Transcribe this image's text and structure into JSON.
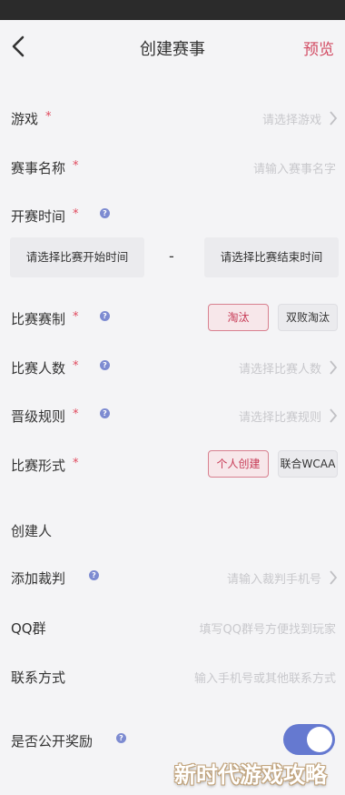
{
  "nav": {
    "title": "创建赛事",
    "preview": "预览"
  },
  "form": {
    "game": {
      "label": "游戏",
      "placeholder": "请选择游戏"
    },
    "event_name": {
      "label": "赛事名称",
      "placeholder": "请输入赛事名字"
    },
    "start_time": {
      "label": "开赛时间",
      "start_placeholder": "请选择比赛开始时间",
      "separator": "-",
      "end_placeholder": "请选择比赛结束时间"
    },
    "format": {
      "label": "比赛赛制",
      "options": [
        "淘汰",
        "双败淘汰"
      ],
      "selected": "淘汰"
    },
    "players": {
      "label": "比赛人数",
      "placeholder": "请选择比赛人数"
    },
    "advance_rule": {
      "label": "晋级规则",
      "placeholder": "请选择比赛规则"
    },
    "form_type": {
      "label": "比赛形式",
      "options": [
        "个人创建",
        "联合WCAA"
      ],
      "selected": "个人创建"
    },
    "creator": {
      "label": "创建人"
    },
    "referee": {
      "label": "添加裁判",
      "placeholder": "请输入裁判手机号"
    },
    "qq": {
      "label": "QQ群",
      "placeholder": "填写QQ群号方便找到玩家"
    },
    "contact": {
      "label": "联系方式",
      "placeholder": "输入手机号或其他联系方式"
    },
    "public_reward": {
      "label": "是否公开奖励",
      "enabled": true
    }
  },
  "required_mark": "*",
  "help_mark": "?",
  "watermark": "新时代游戏攻略",
  "colors": {
    "accent": "#d24b63",
    "toggle": "#6579d0",
    "help": "#7d8bd1"
  }
}
